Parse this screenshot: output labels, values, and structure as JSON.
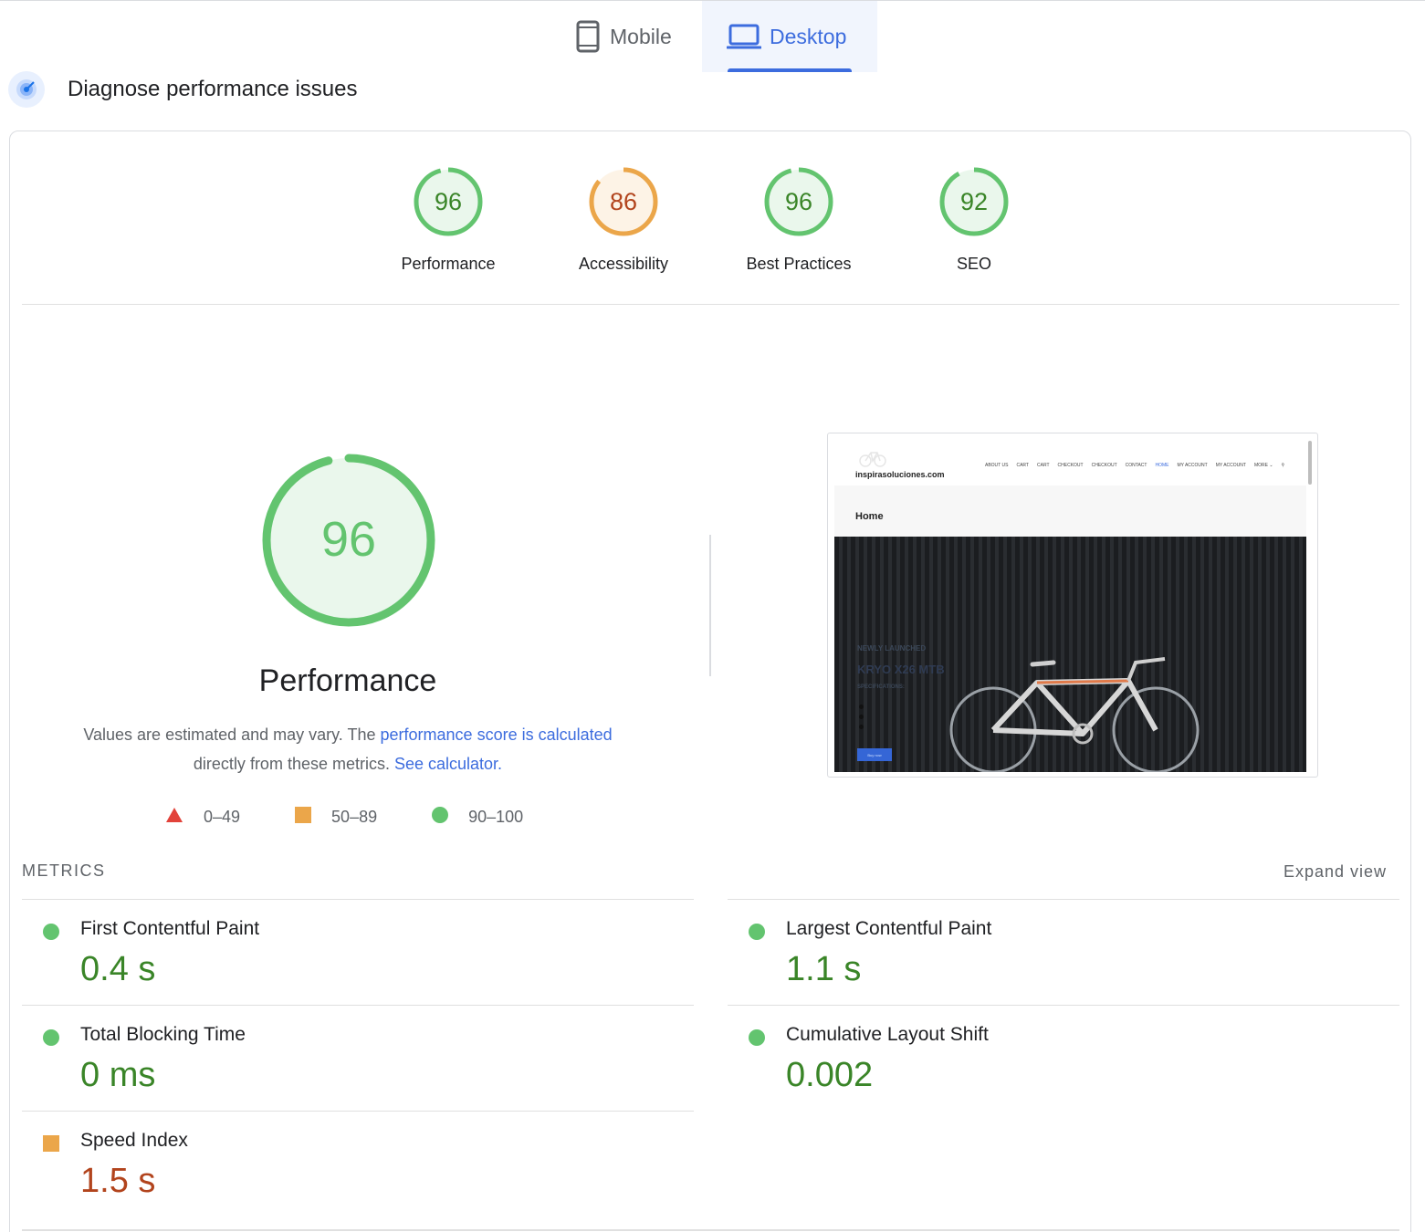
{
  "tabs": {
    "mobile": {
      "label": "Mobile",
      "icon": "smartphone-icon"
    },
    "desktop": {
      "label": "Desktop",
      "icon": "laptop-icon",
      "active": true
    }
  },
  "section": {
    "title": "Diagnose performance issues",
    "icon": "speedometer-icon"
  },
  "scores": [
    {
      "label": "Performance",
      "value": "96",
      "status": "good"
    },
    {
      "label": "Accessibility",
      "value": "86",
      "status": "average"
    },
    {
      "label": "Best Practices",
      "value": "96",
      "status": "good"
    },
    {
      "label": "SEO",
      "value": "92",
      "status": "good"
    }
  ],
  "performance": {
    "score": "96",
    "title": "Performance",
    "desc_prefix": "Values are estimated and may vary. The ",
    "desc_link": "performance score is calculated",
    "desc_middle": "directly from these metrics. ",
    "calc_link": "See calculator."
  },
  "legend": [
    {
      "range": "0–49",
      "shape": "triangle",
      "color": "#e2423a"
    },
    {
      "range": "50–89",
      "shape": "square",
      "color": "#eba64a"
    },
    {
      "range": "90–100",
      "shape": "circle",
      "color": "#63c46f"
    }
  ],
  "screenshot": {
    "brand": "inspirasoluciones.com",
    "nav": [
      "ABOUT US",
      "CART",
      "CART",
      "CHECKOUT",
      "CHECKOUT",
      "CONTACT",
      "HOME",
      "MY ACCOUNT",
      "MY ACCOUNT",
      "MORE ⌄"
    ],
    "page_title": "Home",
    "hero_small": "NEWLY LAUNCHED",
    "hero_title": "KRYO X26 MTB",
    "hero_spec": "SPECIFICATIONS:",
    "hero_button": "Buy now"
  },
  "metrics_header": "METRICS",
  "expand_label": "Expand view",
  "metrics": [
    {
      "name": "First Contentful Paint",
      "value": "0.4 s",
      "status": "good"
    },
    {
      "name": "Largest Contentful Paint",
      "value": "1.1 s",
      "status": "good"
    },
    {
      "name": "Total Blocking Time",
      "value": "0 ms",
      "status": "good"
    },
    {
      "name": "Cumulative Layout Shift",
      "value": "0.002",
      "status": "good"
    },
    {
      "name": "Speed Index",
      "value": "1.5 s",
      "status": "average"
    }
  ],
  "colors": {
    "good": "#3a8528",
    "good_ring": "#63c46f",
    "average": "#b2441d",
    "average_ring": "#eba64a",
    "accent": "#3c6cde"
  }
}
